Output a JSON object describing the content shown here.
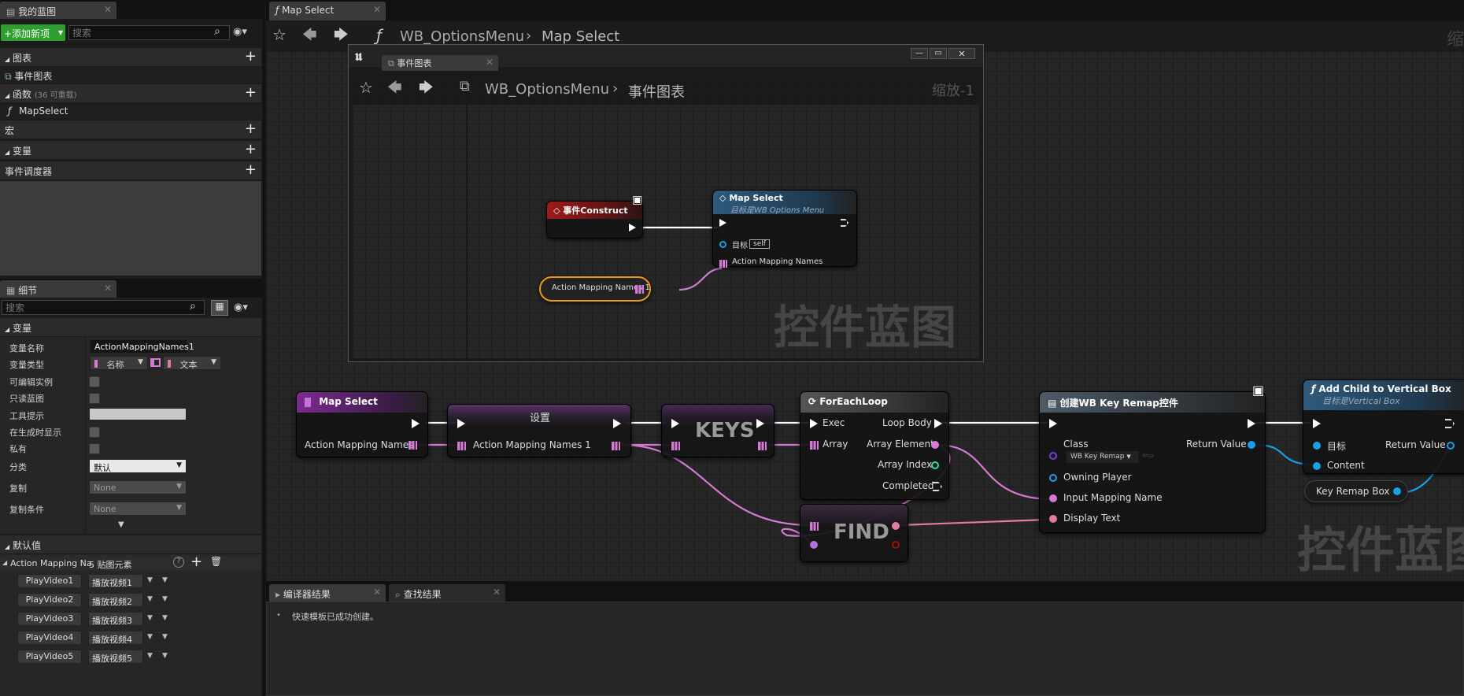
{
  "left_panel": {
    "tab_title": "我的蓝图",
    "add_button": "+添加新项",
    "search_placeholder": "搜索",
    "sections": {
      "graphs": "图表",
      "event_graph_item": "事件图表",
      "functions": "函数",
      "functions_count": "(36 可重载)",
      "map_select_item": "MapSelect",
      "macros": "宏",
      "variables": "变量",
      "event_dispatchers": "事件调度器"
    }
  },
  "details": {
    "tab_title": "细节",
    "search_placeholder": "搜索",
    "variable_section": "变量",
    "props": {
      "var_name_label": "变量名称",
      "var_name_value": "ActionMappingNames1",
      "var_type_label": "变量类型",
      "var_type_key": "名称",
      "var_type_value": "文本",
      "editable_label": "可编辑实例",
      "readonly_label": "只读蓝图",
      "tooltip_label": "工具提示",
      "show_spawn_label": "在生成时显示",
      "private_label": "私有",
      "category_label": "分类",
      "category_value": "默认",
      "replication_label": "复制",
      "replication_value": "None",
      "rep_condition_label": "复制条件",
      "rep_condition_value": "None"
    },
    "defaults_section": "默认值",
    "map_label": "Action Mapping Na",
    "map_count": "5 贴图元素",
    "map_entries": [
      {
        "key": "PlayVideo1",
        "value": "播放视频1"
      },
      {
        "key": "PlayVideo2",
        "value": "播放视频2"
      },
      {
        "key": "PlayVideo3",
        "value": "播放视频3"
      },
      {
        "key": "PlayVideo4",
        "value": "播放视频4"
      },
      {
        "key": "PlayVideo5",
        "value": "播放视频5"
      }
    ]
  },
  "main": {
    "tab_title": "Map Select",
    "breadcrumb_root": "WB_OptionsMenu",
    "breadcrumb_leaf": "Map Select",
    "zoom_partial": "缩",
    "watermark": "控件蓝图"
  },
  "popup": {
    "tab_title": "事件图表",
    "breadcrumb_root": "WB_OptionsMenu",
    "breadcrumb_leaf": "事件图表",
    "zoom": "缩放-1",
    "watermark": "控件蓝图",
    "event_construct": "事件Construct",
    "map_select_title": "Map Select",
    "map_select_subtitle": "目标是WB Options Menu",
    "target_label": "目标",
    "target_self": "self",
    "action_pin": "Action Mapping Names",
    "var_node": "Action Mapping Names 1"
  },
  "graph": {
    "map_select": {
      "title": "Map Select",
      "pin": "Action Mapping Names"
    },
    "set": {
      "title": "设置",
      "pin": "Action Mapping Names 1"
    },
    "keys": "KEYS",
    "foreach": {
      "title": "ForEachLoop",
      "exec": "Exec",
      "loop_body": "Loop Body",
      "array": "Array",
      "array_element": "Array Element",
      "array_index": "Array Index",
      "completed": "Completed"
    },
    "find": "FIND",
    "create": {
      "title": "创建WB Key Remap控件",
      "class": "Class",
      "class_value": "WB Key Remap",
      "return_value": "Return Value",
      "owning_player": "Owning Player",
      "input_mapping": "Input Mapping Name",
      "display_text": "Display Text"
    },
    "add_child": {
      "title": "Add Child to Vertical Box",
      "subtitle": "目标是Vertical Box",
      "target": "目标",
      "return_value": "Return Value",
      "content": "Content"
    },
    "key_remap_box": "Key Remap Box"
  },
  "bottom": {
    "compiler_tab": "编译器结果",
    "find_tab": "查找结果",
    "message": "快速模板已成功创建。"
  },
  "colors": {
    "accent_green": "#2e9f2e",
    "struct_pink": "#d47ad4",
    "object_blue": "#1a9ee8",
    "text_pink": "#e37aa0",
    "event_red": "#8c1414"
  }
}
